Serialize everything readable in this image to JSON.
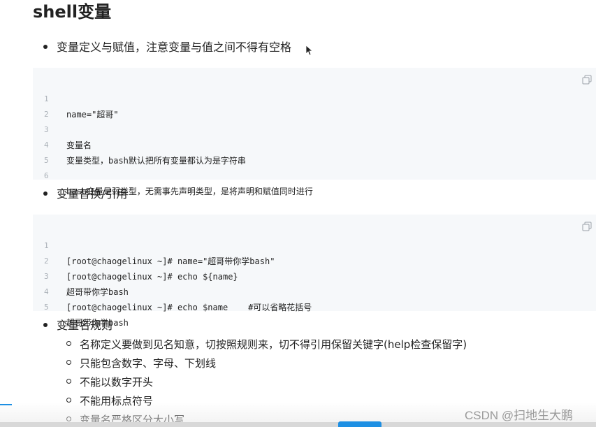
{
  "title": "shell变量",
  "bullets": [
    "变量定义与赋值，注意变量与值之间不得有空格",
    "变量替换/引用",
    "变量名规则"
  ],
  "code_block_1": {
    "lines": [
      {
        "n": "1",
        "text": "name=\"超哥\""
      },
      {
        "n": "2",
        "text": ""
      },
      {
        "n": "3",
        "text": "变量名"
      },
      {
        "n": "4",
        "text": "变量类型，bash默认把所有变量都认为是字符串"
      },
      {
        "n": "5",
        "text": ""
      },
      {
        "n": "6",
        "text": "bash变量是弱类型，无需事先声明类型，是将声明和赋值同时进行"
      }
    ]
  },
  "code_block_2": {
    "lines": [
      {
        "n": "1",
        "text": "[root@chaogelinux ~]# name=\"超哥带你学bash\""
      },
      {
        "n": "2",
        "text": "[root@chaogelinux ~]# echo ${name}"
      },
      {
        "n": "3",
        "text": "超哥带你学bash"
      },
      {
        "n": "4",
        "text": "[root@chaogelinux ~]# echo $name    #可以省略花括号"
      },
      {
        "n": "5",
        "text": "超哥带你学bash"
      }
    ]
  },
  "rules": [
    "名称定义要做到见名知意，切按照规则来，切不得引用保留关键字(help检查保留字)",
    "只能包含数字、字母、下划线",
    "不能以数字开头",
    "不能用标点符号",
    "变量名严格区分大小写"
  ],
  "watermark": "CSDN @扫地生大鹏",
  "icons": {
    "copy": "copy-icon",
    "cursor": "mouse-pointer-icon"
  }
}
